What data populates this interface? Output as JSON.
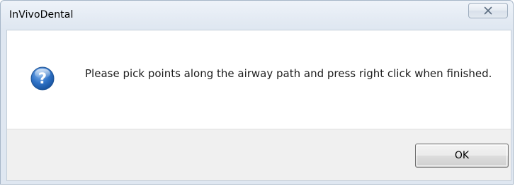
{
  "window": {
    "title": "InVivoDental",
    "close_glyph": "✕"
  },
  "dialog": {
    "icon": "question-icon",
    "message": "Please pick points along the airway path and press right click when finished.",
    "ok_label": "OK"
  },
  "colors": {
    "icon_blue": "#1c5fb0",
    "frame": "#a6b6c8",
    "footer_bg": "#f0f0f0"
  }
}
